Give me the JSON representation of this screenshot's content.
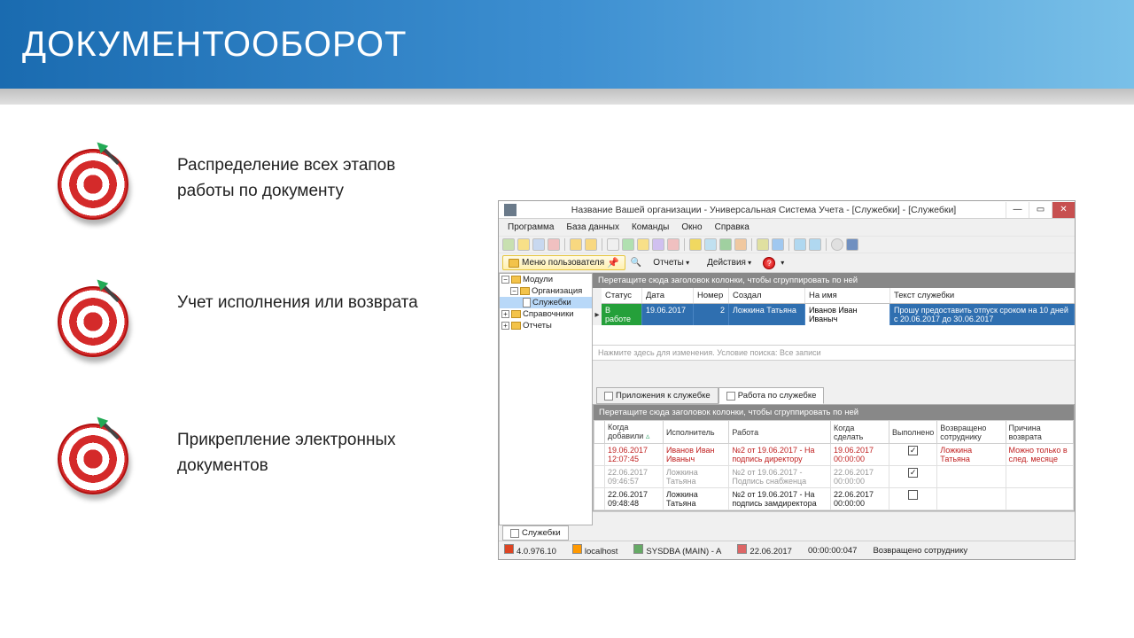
{
  "slide": {
    "title": "ДОКУМЕНТООБОРОТ",
    "bullets": [
      "Распределение всех этапов работы по документу",
      "Учет исполнения или возврата",
      "Прикрепление электронных документов"
    ]
  },
  "window": {
    "title": "Название Вашей организации - Универсальная Система Учета - [Служебки] - [Служебки]",
    "menu": [
      "Программа",
      "База данных",
      "Команды",
      "Окно",
      "Справка"
    ],
    "usermenu": "Меню пользователя",
    "sub_reports": "Отчеты",
    "sub_actions": "Действия",
    "tree": {
      "root": "Модули",
      "lvl1": "Организация",
      "lvl2": "Служебки",
      "ref": "Справочники",
      "rep": "Отчеты"
    },
    "group_hint": "Перетащите сюда заголовок колонки, чтобы сгруппировать по ней",
    "cols": {
      "status": "Статус",
      "date": "Дата",
      "num": "Номер",
      "creator": "Создал",
      "to": "На имя",
      "text": "Текст служебки"
    },
    "row": {
      "status": "В работе",
      "date": "19.06.2017",
      "num": "2",
      "creator": "Ложкина Татьяна",
      "to": "Иванов Иван Иваныч",
      "text": "Прошу предоставить отпуск сроком на 10 дней с 20.06.2017 до 30.06.2017"
    },
    "search_hint": "Нажмите здесь для изменения. Условие поиска: Все записи",
    "tab_attach": "Приложения к служебке",
    "tab_work": "Работа по служебке",
    "lower_cols": {
      "added": "Когда добавили",
      "exec": "Исполнитель",
      "work": "Работа",
      "due": "Когда сделать",
      "done": "Выполнено",
      "ret": "Возвращено сотруднику",
      "reason": "Причина возврата"
    },
    "lower_rows": [
      {
        "added": "19.06.2017 12:07:45",
        "exec": "Иванов Иван Иваныч",
        "work": "№2 от 19.06.2017 - На подпись директору",
        "due": "19.06.2017 00:00:00",
        "done": true,
        "ret": "Ложкина Татьяна",
        "reason": "Можно только в след. месяце",
        "red": true
      },
      {
        "added": "22.06.2017 09:46:57",
        "exec": "Ложкина Татьяна",
        "work": "№2 от 19.06.2017 - Подпись снабженца",
        "due": "22.06.2017 00:00:00",
        "done": true,
        "ret": "",
        "reason": "",
        "grey": true
      },
      {
        "added": "22.06.2017 09:48:48",
        "exec": "Ложкина Татьяна",
        "work": "№2 от 19.06.2017 - На подпись замдиректора",
        "due": "22.06.2017 00:00:00",
        "done": false,
        "ret": "",
        "reason": ""
      }
    ],
    "footer_tab": "Служебки",
    "status": {
      "ver": "4.0.976.10",
      "host": "localhost",
      "user": "SYSDBA (MAIN) - A",
      "date": "22.06.2017",
      "time": "00:00:00:047",
      "msg": "Возвращено сотруднику"
    }
  }
}
